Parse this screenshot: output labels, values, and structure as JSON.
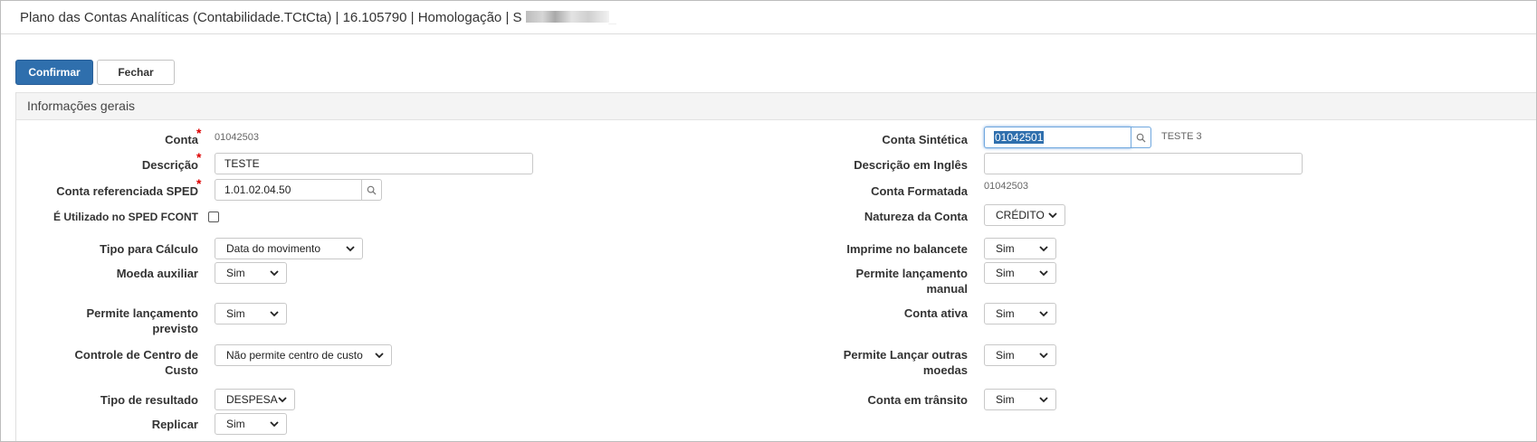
{
  "window": {
    "title": "Plano das Contas Analíticas (Contabilidade.TCtCta) | 16.105790 | Homologação | S",
    "title_suffix": "_"
  },
  "toolbar": {
    "confirm_label": "Confirmar",
    "close_label": "Fechar"
  },
  "section": {
    "title": "Informações gerais"
  },
  "form_left": {
    "conta_label": "Conta",
    "conta_value": "01042503",
    "descricao_label": "Descrição",
    "descricao_value": "TESTE",
    "sped_label": "Conta referenciada SPED",
    "sped_value": "1.01.02.04.50",
    "fcont_label": "É Utilizado no SPED FCONT",
    "tipo_calculo_label": "Tipo para Cálculo",
    "tipo_calculo_value": "Data do movimento",
    "moeda_label": "Moeda auxiliar",
    "moeda_value": "Sim",
    "lanc_previsto_label1": "Permite lançamento",
    "lanc_previsto_label2": "previsto",
    "lanc_previsto_value": "Sim",
    "centro_custo_label1": "Controle de Centro de",
    "centro_custo_label2": "Custo",
    "centro_custo_value": "Não permite centro de custo",
    "tipo_resultado_label": "Tipo de resultado",
    "tipo_resultado_value": "DESPESA",
    "replicar_label": "Replicar",
    "replicar_value": "Sim"
  },
  "form_right": {
    "sintetica_label": "Conta Sintética",
    "sintetica_value": "01042501",
    "sintetica_desc": "TESTE 3",
    "desc_ingles_label": "Descrição em Inglês",
    "desc_ingles_value": "",
    "formatada_label": "Conta Formatada",
    "formatada_value": "01042503",
    "natureza_label": "Natureza da Conta",
    "natureza_value": "CRÉDITO",
    "balancete_label": "Imprime no balancete",
    "balancete_value": "Sim",
    "lanc_manual_label1": "Permite lançamento",
    "lanc_manual_label2": "manual",
    "lanc_manual_value": "Sim",
    "ativa_label": "Conta ativa",
    "ativa_value": "Sim",
    "outras_moedas_label1": "Permite Lançar outras",
    "outras_moedas_label2": "moedas",
    "outras_moedas_value": "Sim",
    "transito_label": "Conta em trânsito",
    "transito_value": "Sim"
  },
  "icons": {
    "lookup": "search-icon",
    "dropdown": "chevron-down-icon"
  },
  "colors": {
    "primary_button": "#2f6fad",
    "required_mark": "#dd0000",
    "focus_border": "#6fa7de"
  }
}
